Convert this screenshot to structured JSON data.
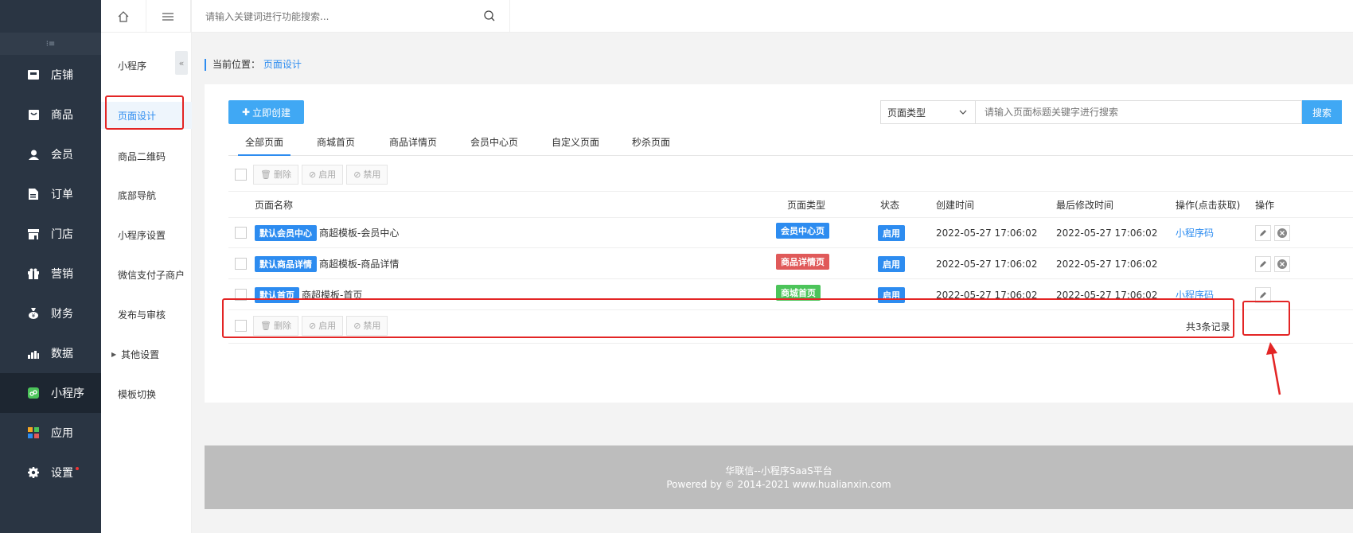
{
  "sidebar": {
    "items": [
      {
        "label": "店铺",
        "icon": "shop-icon"
      },
      {
        "label": "商品",
        "icon": "goods-icon"
      },
      {
        "label": "会员",
        "icon": "member-icon"
      },
      {
        "label": "订单",
        "icon": "order-icon"
      },
      {
        "label": "门店",
        "icon": "store-icon"
      },
      {
        "label": "营销",
        "icon": "gift-icon"
      },
      {
        "label": "财务",
        "icon": "finance-icon"
      },
      {
        "label": "数据",
        "icon": "chart-icon"
      },
      {
        "label": "小程序",
        "icon": "miniapp-icon"
      },
      {
        "label": "应用",
        "icon": "apps-icon"
      },
      {
        "label": "设置",
        "icon": "gear-icon"
      }
    ]
  },
  "subnav": {
    "title": "小程序",
    "items": [
      "页面设计",
      "商品二维码",
      "底部导航",
      "小程序设置",
      "微信支付子商户",
      "发布与审核",
      "其他设置",
      "模板切换"
    ]
  },
  "topbar": {
    "search_placeholder": "请输入关键词进行功能搜索..."
  },
  "breadcrumb": {
    "prefix": "当前位置：",
    "current": "页面设计"
  },
  "toolbar": {
    "create_label": "立即创建",
    "type_select": "页面类型",
    "keyword_placeholder": "请输入页面标题关键字进行搜索",
    "search_label": "搜索"
  },
  "tabs": [
    "全部页面",
    "商城首页",
    "商品详情页",
    "会员中心页",
    "自定义页面",
    "秒杀页面"
  ],
  "actions": {
    "delete": "删除",
    "enable": "启用",
    "disable": "禁用"
  },
  "table": {
    "headers": [
      "页面名称",
      "页面类型",
      "状态",
      "创建时间",
      "最后修改时间",
      "操作(点击获取)",
      "操作"
    ],
    "rows": [
      {
        "tag": "默认会员中心",
        "name": "商超模板-会员中心",
        "type": "会员中心页",
        "type_color": "#2d8cf0",
        "status": "启用",
        "created": "2022-05-27 17:06:02",
        "modified": "2022-05-27 17:06:02",
        "op_link": "小程序码"
      },
      {
        "tag": "默认商品详情",
        "name": "商超模板-商品详情",
        "type": "商品详情页",
        "type_color": "#e05a5a",
        "status": "启用",
        "created": "2022-05-27 17:06:02",
        "modified": "2022-05-27 17:06:02",
        "op_link": ""
      },
      {
        "tag": "默认首页",
        "name": "商超模板-首页",
        "type": "商城首页",
        "type_color": "#4cc45a",
        "status": "启用",
        "created": "2022-05-27 17:06:02",
        "modified": "2022-05-27 17:06:02",
        "op_link": "小程序码"
      }
    ],
    "total": "共3条记录"
  },
  "footer": {
    "line1": "华联信--小程序SaaS平台",
    "line2": "Powered by © 2014-2021 www.hualianxin.com"
  },
  "colors": {
    "accent": "#2d8cf0",
    "button": "#40a8f4",
    "sidebar_bg": "#2a3543",
    "highlight": "#e32525"
  }
}
